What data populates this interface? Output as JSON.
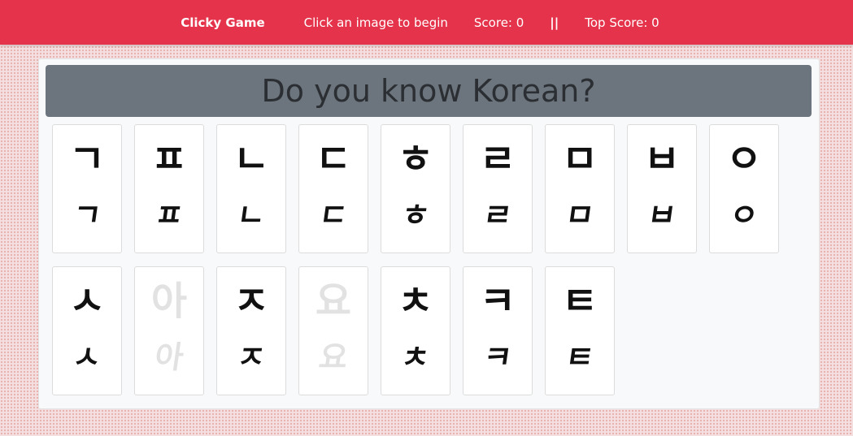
{
  "navbar": {
    "brand": "Clicky Game",
    "instruction": "Click an image to begin",
    "score": "Score: 0",
    "separator": "||",
    "top_score": "Top Score: 0"
  },
  "main": {
    "title": "Do you know Korean?"
  },
  "cards": [
    {
      "glyph": "ㄱ",
      "faded": false
    },
    {
      "glyph": "ㅍ",
      "faded": false
    },
    {
      "glyph": "ㄴ",
      "faded": false
    },
    {
      "glyph": "ㄷ",
      "faded": false
    },
    {
      "glyph": "ㅎ",
      "faded": false
    },
    {
      "glyph": "ㄹ",
      "faded": false
    },
    {
      "glyph": "ㅁ",
      "faded": false
    },
    {
      "glyph": "ㅂ",
      "faded": false
    },
    {
      "glyph": "ㅇ",
      "faded": false
    },
    {
      "glyph": "ㅅ",
      "faded": false
    },
    {
      "glyph": "아",
      "faded": true
    },
    {
      "glyph": "ㅈ",
      "faded": false
    },
    {
      "glyph": "요",
      "faded": true
    },
    {
      "glyph": "ㅊ",
      "faded": false
    },
    {
      "glyph": "ㅋ",
      "faded": false
    },
    {
      "glyph": "ㅌ",
      "faded": false
    }
  ],
  "colors": {
    "navbar": "#e4334a",
    "title_bar": "#6c757d"
  }
}
